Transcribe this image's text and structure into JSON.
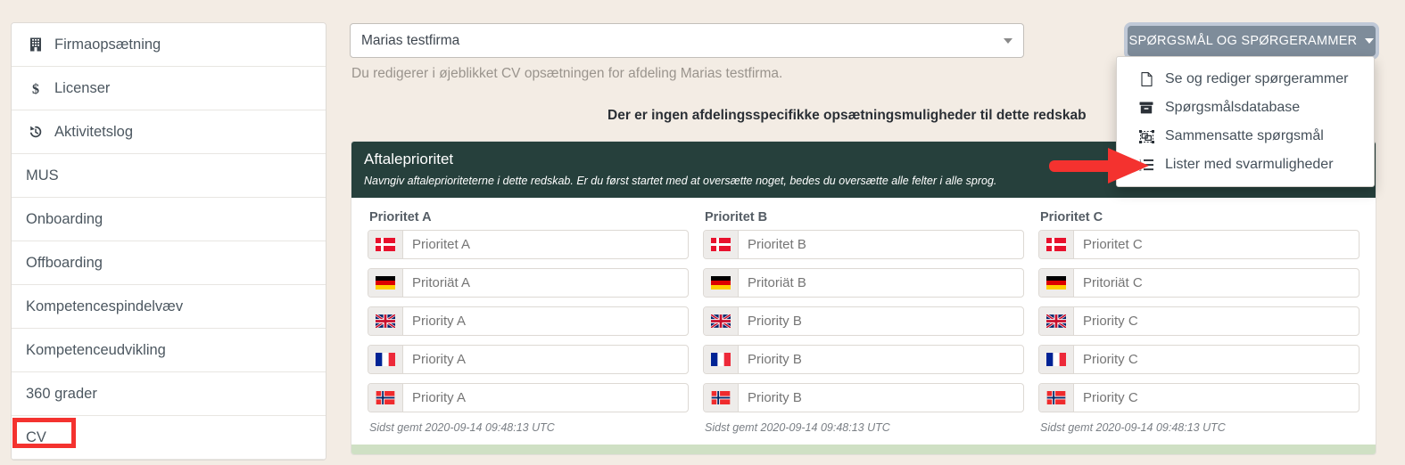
{
  "page": {
    "background_color": "#f3ece4",
    "accent_panel_color": "#26403c",
    "button_color": "#7e8c9a",
    "annotation_color": "#f4322f",
    "footer_bar_color": "#cfe0c4"
  },
  "sidebar": {
    "items": [
      {
        "label": "Firmaopsætning",
        "icon": "building-icon"
      },
      {
        "label": "Licenser",
        "icon": "dollar-icon"
      },
      {
        "label": "Aktivitetslog",
        "icon": "history-icon"
      },
      {
        "label": "MUS",
        "icon": ""
      },
      {
        "label": "Onboarding",
        "icon": ""
      },
      {
        "label": "Offboarding",
        "icon": ""
      },
      {
        "label": "Kompetencespindelvæv",
        "icon": ""
      },
      {
        "label": "Kompetenceudvikling",
        "icon": ""
      },
      {
        "label": "360 grader",
        "icon": ""
      },
      {
        "label": "CV",
        "icon": ""
      }
    ]
  },
  "header": {
    "firm_select_value": "Marias testfirma",
    "edit_note": "Du redigerer i øjeblikket CV opsætningen for afdeling Marias testfirma.",
    "no_dept_heading": "Der er ingen afdelingsspecifikke opsætningsmuligheder til dette redskab"
  },
  "dropdown": {
    "button_label": "SPØRGSMÅL OG SPØRGERAMMER",
    "items": [
      {
        "label": "Se og rediger spørgerammer",
        "icon": "file-icon"
      },
      {
        "label": "Spørgsmålsdatabase",
        "icon": "archive-icon"
      },
      {
        "label": "Sammensatte spørgsmål",
        "icon": "object-group-icon"
      },
      {
        "label": "Lister med svarmuligheder",
        "icon": "ordered-list-icon"
      }
    ]
  },
  "panel": {
    "title": "Aftaleprioritet",
    "subtitle": "Navngiv aftaleprioriteterne i dette redskab. Er du først startet med at oversætte noget, bedes du oversætte alle felter i alle sprog.",
    "columns": [
      {
        "title": "Prioritet A",
        "saved_note": "Sidst gemt 2020-09-14 09:48:13 UTC",
        "fields": [
          {
            "flag": "flag-dk",
            "placeholder": "Prioritet A"
          },
          {
            "flag": "flag-de",
            "placeholder": "Pritoriät A"
          },
          {
            "flag": "flag-gb",
            "placeholder": "Priority A"
          },
          {
            "flag": "flag-fr",
            "placeholder": "Priority A"
          },
          {
            "flag": "flag-no",
            "placeholder": "Priority A"
          }
        ]
      },
      {
        "title": "Prioritet B",
        "saved_note": "Sidst gemt 2020-09-14 09:48:13 UTC",
        "fields": [
          {
            "flag": "flag-dk",
            "placeholder": "Prioritet B"
          },
          {
            "flag": "flag-de",
            "placeholder": "Pritoriät B"
          },
          {
            "flag": "flag-gb",
            "placeholder": "Priority B"
          },
          {
            "flag": "flag-fr",
            "placeholder": "Priority B"
          },
          {
            "flag": "flag-no",
            "placeholder": "Priority B"
          }
        ]
      },
      {
        "title": "Prioritet C",
        "saved_note": "Sidst gemt 2020-09-14 09:48:13 UTC",
        "fields": [
          {
            "flag": "flag-dk",
            "placeholder": "Prioritet C"
          },
          {
            "flag": "flag-de",
            "placeholder": "Pritoriät C"
          },
          {
            "flag": "flag-gb",
            "placeholder": "Priority C"
          },
          {
            "flag": "flag-fr",
            "placeholder": "Priority C"
          },
          {
            "flag": "flag-no",
            "placeholder": "Priority C"
          }
        ]
      }
    ]
  },
  "annotations": {
    "highlight_target": "CV",
    "arrow_target": "Lister med svarmuligheder"
  }
}
